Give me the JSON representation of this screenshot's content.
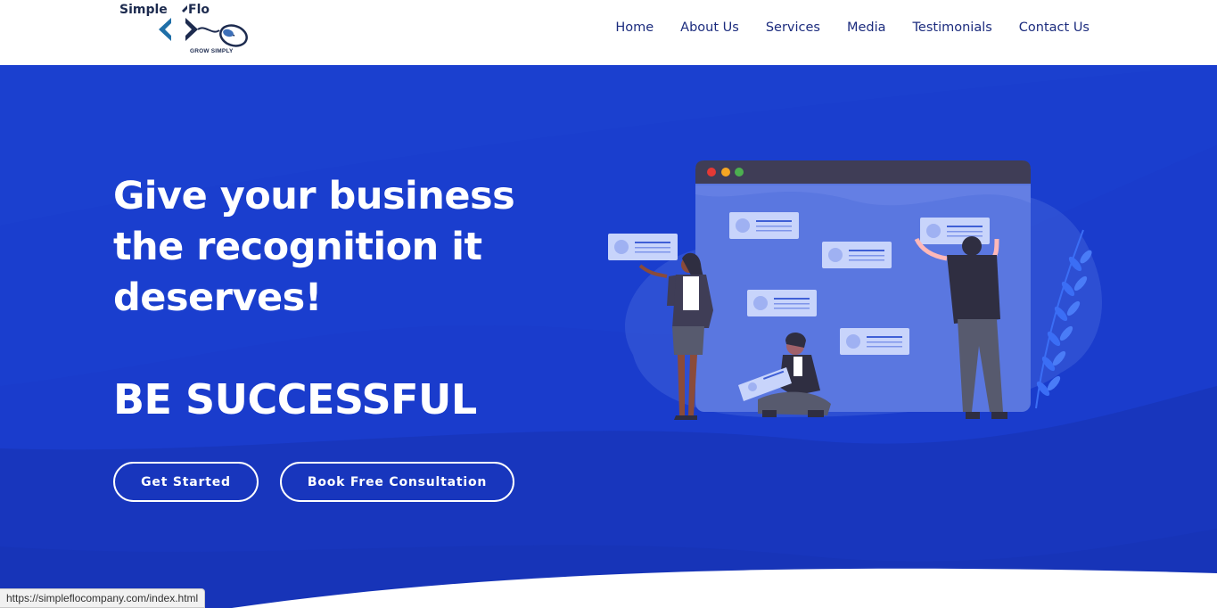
{
  "logo": {
    "word1": "Simple",
    "word2": "Flo",
    "tagline": "GROW SIMPLY"
  },
  "nav": {
    "items": [
      {
        "label": "Home"
      },
      {
        "label": "About Us"
      },
      {
        "label": "Services"
      },
      {
        "label": "Media"
      },
      {
        "label": "Testimonials"
      },
      {
        "label": "Contact Us"
      }
    ]
  },
  "hero": {
    "headline_lines": [
      "Give your business",
      "the recognition it",
      "deserves!"
    ],
    "subheadline": "BE SUCCESSFUL",
    "primary_button": "Get Started",
    "secondary_button": "Book Free Consultation"
  },
  "status_bar": {
    "url": "https://simpleflocompany.com/index.html"
  },
  "colors": {
    "hero_blue": "#1a3ccc",
    "nav_text": "#1c2c7e",
    "window_bar": "#3f3d56",
    "card": "#c8d4fb"
  },
  "icons": {
    "logo_mark": "code-bracket-mouse-icon",
    "window_dots": "window-controls-icon",
    "profile_cards": "profile-card-icon",
    "plant": "leaf-plant-icon"
  }
}
